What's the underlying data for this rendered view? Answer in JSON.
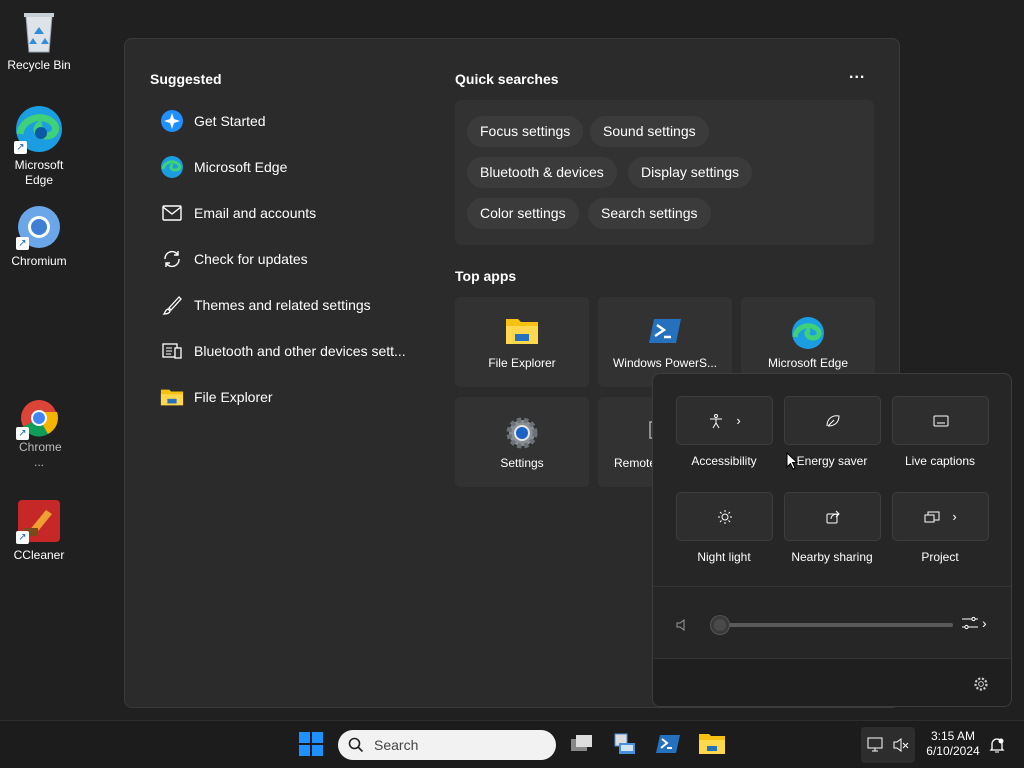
{
  "desktop": {
    "icons": [
      {
        "label": "Recycle Bin"
      },
      {
        "label": "Microsoft Edge"
      },
      {
        "label": "Chromium"
      },
      {
        "label": "Chrome ..."
      },
      {
        "label": "CCleaner"
      }
    ]
  },
  "search_panel": {
    "suggested_title": "Suggested",
    "suggested": [
      {
        "label": "Get Started",
        "icon": "get-started-icon"
      },
      {
        "label": "Microsoft Edge",
        "icon": "edge-icon"
      },
      {
        "label": "Email and accounts",
        "icon": "mail-icon"
      },
      {
        "label": "Check for updates",
        "icon": "refresh-icon"
      },
      {
        "label": "Themes and related settings",
        "icon": "brush-icon"
      },
      {
        "label": "Bluetooth and other devices sett...",
        "icon": "devices-icon"
      },
      {
        "label": "File Explorer",
        "icon": "folder-icon"
      }
    ],
    "quick_searches_title": "Quick searches",
    "more_label": "...",
    "quick_searches": [
      "Focus settings",
      "Sound settings",
      "Bluetooth & devices",
      "Display settings",
      "Color settings",
      "Search settings"
    ],
    "top_apps_title": "Top apps",
    "top_apps": [
      {
        "label": "File Explorer",
        "icon": "folder-icon"
      },
      {
        "label": "Windows PowerS...",
        "icon": "powershell-icon"
      },
      {
        "label": "Microsoft Edge",
        "icon": "edge-icon"
      },
      {
        "label": "Settings",
        "icon": "gear-icon"
      },
      {
        "label": "Remote",
        "icon": "remote-icon"
      }
    ]
  },
  "quick_settings": {
    "tiles": [
      {
        "label": "Accessibility",
        "icon": "accessibility-icon",
        "chevron": true
      },
      {
        "label": "Energy saver",
        "icon": "leaf-icon",
        "chevron": false
      },
      {
        "label": "Live captions",
        "icon": "captions-icon",
        "chevron": false
      },
      {
        "label": "Night light",
        "icon": "brightness-icon",
        "chevron": false
      },
      {
        "label": "Nearby sharing",
        "icon": "share-icon",
        "chevron": false
      },
      {
        "label": "Project",
        "icon": "project-icon",
        "chevron": true
      }
    ],
    "volume_level": 0
  },
  "taskbar": {
    "search_placeholder": "Search",
    "time": "3:15 AM",
    "date": "6/10/2024"
  },
  "colors": {
    "accent": "#0a84ff",
    "folder_yellow": "#f5c211",
    "powershell_blue": "#2671be"
  }
}
